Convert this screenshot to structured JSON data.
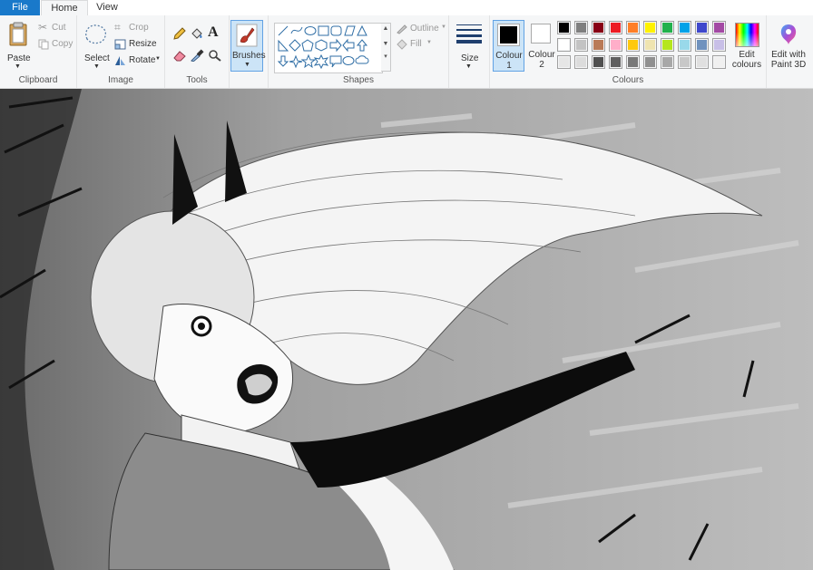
{
  "tabs": {
    "file": "File",
    "home": "Home",
    "view": "View"
  },
  "clipboard": {
    "paste": "Paste",
    "cut": "Cut",
    "copy": "Copy",
    "label": "Clipboard"
  },
  "image": {
    "select": "Select",
    "crop": "Crop",
    "resize": "Resize",
    "rotate": "Rotate",
    "label": "Image"
  },
  "tools": {
    "label": "Tools",
    "brushes": "Brushes"
  },
  "shapes": {
    "outline": "Outline",
    "fill": "Fill",
    "label": "Shapes"
  },
  "size": {
    "label": "Size"
  },
  "colours": {
    "colour1": "Colour 1",
    "colour2": "Colour 2",
    "edit": "Edit colours",
    "paint3d": "Edit with Paint 3D",
    "label": "Colours",
    "colour1_value": "#000000",
    "colour2_value": "#ffffff",
    "palette_row1": [
      "#000000",
      "#7f7f7f",
      "#880015",
      "#ed1c24",
      "#ff7f27",
      "#fff200",
      "#22b14c",
      "#00a2e8",
      "#3f48cc",
      "#a349a4"
    ],
    "palette_row2": [
      "#ffffff",
      "#c3c3c3",
      "#b97a57",
      "#ffaec9",
      "#ffc90e",
      "#efe4b0",
      "#b5e61d",
      "#99d9ea",
      "#7092be",
      "#c8bfe7"
    ],
    "palette_row3": [
      "#e6e6e6",
      "#dcdcdc",
      "#505050",
      "#606060",
      "#787878",
      "#909090",
      "#a8a8a8",
      "#c8c8c8",
      "#e0e0e0",
      "#f0f0f0"
    ]
  },
  "canvas": {
    "description_icon": "anime-sketch-drawing"
  }
}
